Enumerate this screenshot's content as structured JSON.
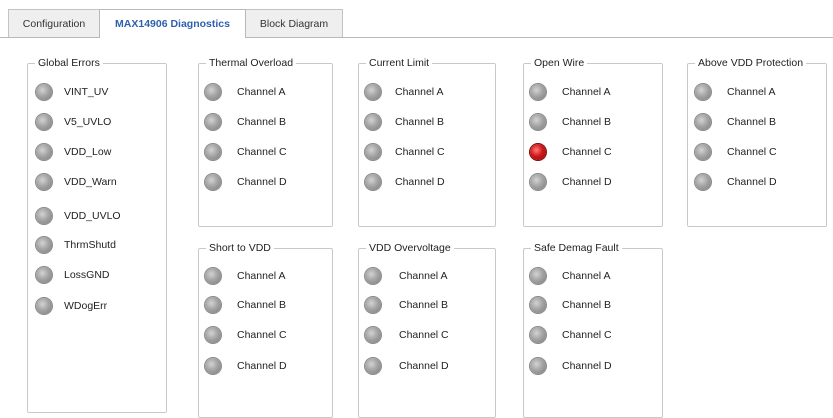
{
  "tabs": [
    {
      "label": "Configuration"
    },
    {
      "label": "MAX14906 Diagnostics"
    },
    {
      "label": "Block Diagram"
    }
  ],
  "active_tab": "MAX14906 Diagnostics",
  "colors": {
    "led_off": "#a4a4a4",
    "led_on": "#d01818",
    "active_tab_text": "#2f5fae"
  },
  "groups": {
    "global_errors": {
      "title": "Global Errors",
      "items": [
        {
          "label": "VINT_UV",
          "on": false
        },
        {
          "label": "V5_UVLO",
          "on": false
        },
        {
          "label": "VDD_Low",
          "on": false
        },
        {
          "label": "VDD_Warn",
          "on": false
        },
        {
          "label": "VDD_UVLO",
          "on": false
        },
        {
          "label": "ThrmShutd",
          "on": false
        },
        {
          "label": "LossGND",
          "on": false
        },
        {
          "label": "WDogErr",
          "on": false
        }
      ]
    },
    "thermal_overload": {
      "title": "Thermal Overload",
      "items": [
        {
          "label": "Channel A",
          "on": false
        },
        {
          "label": "Channel B",
          "on": false
        },
        {
          "label": "Channel C",
          "on": false
        },
        {
          "label": "Channel D",
          "on": false
        }
      ]
    },
    "current_limit": {
      "title": "Current Limit",
      "items": [
        {
          "label": "Channel A",
          "on": false
        },
        {
          "label": "Channel B",
          "on": false
        },
        {
          "label": "Channel C",
          "on": false
        },
        {
          "label": "Channel D",
          "on": false
        }
      ]
    },
    "open_wire": {
      "title": "Open Wire",
      "items": [
        {
          "label": "Channel A",
          "on": false
        },
        {
          "label": "Channel B",
          "on": false
        },
        {
          "label": "Channel C",
          "on": true
        },
        {
          "label": "Channel D",
          "on": false
        }
      ]
    },
    "above_vdd_protection": {
      "title": "Above VDD Protection",
      "items": [
        {
          "label": "Channel A",
          "on": false
        },
        {
          "label": "Channel B",
          "on": false
        },
        {
          "label": "Channel C",
          "on": false
        },
        {
          "label": "Channel D",
          "on": false
        }
      ]
    },
    "short_to_vdd": {
      "title": "Short to VDD",
      "items": [
        {
          "label": "Channel A",
          "on": false
        },
        {
          "label": "Channel B",
          "on": false
        },
        {
          "label": "Channel C",
          "on": false
        },
        {
          "label": "Channel D",
          "on": false
        }
      ]
    },
    "vdd_overvoltage": {
      "title": "VDD Overvoltage",
      "items": [
        {
          "label": "Channel A",
          "on": false
        },
        {
          "label": "Channel B",
          "on": false
        },
        {
          "label": "Channel C",
          "on": false
        },
        {
          "label": "Channel D",
          "on": false
        }
      ]
    },
    "safe_demag_fault": {
      "title": "Safe Demag Fault",
      "items": [
        {
          "label": "Channel A",
          "on": false
        },
        {
          "label": "Channel B",
          "on": false
        },
        {
          "label": "Channel C",
          "on": false
        },
        {
          "label": "Channel D",
          "on": false
        }
      ]
    }
  }
}
